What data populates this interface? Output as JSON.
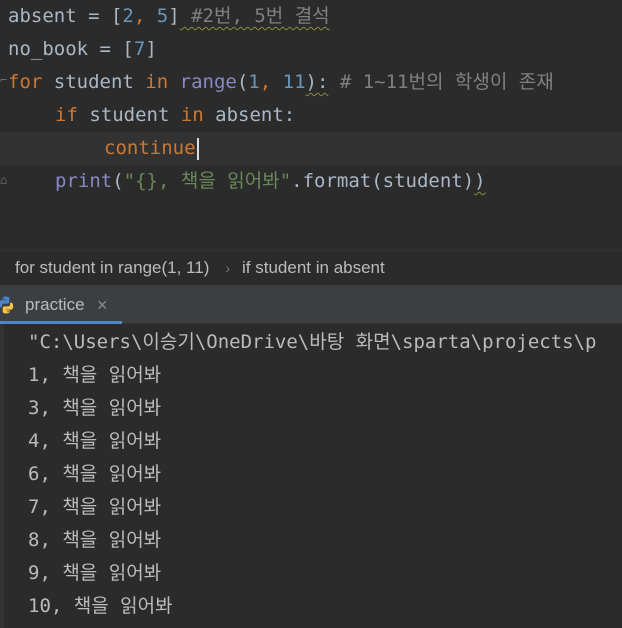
{
  "editor": {
    "line1": {
      "var": "absent",
      "op": " = ",
      "open": "[",
      "n1": "2",
      "sep": ", ",
      "n2": "5",
      "close": "]",
      "comment": " #2번, 5번 결석"
    },
    "line2": {
      "var": "no_book",
      "op": " = ",
      "open": "[",
      "n1": "7",
      "close": "]"
    },
    "line3": {
      "kw_for": "for",
      "var": " student ",
      "kw_in": "in",
      "sp": " ",
      "builtin": "range",
      "open": "(",
      "n1": "1",
      "sep": ", ",
      "n2": "11",
      "close": "):",
      "comment": " # 1~11번의 학생이 존재"
    },
    "line4": {
      "kw_if": "if",
      "var": " student ",
      "kw_in": "in",
      "rest": " absent:"
    },
    "line5": {
      "kw": "continue"
    },
    "line6": {
      "builtin": "print",
      "open": "(",
      "str": "\"{}, 책을 읽어봐\"",
      "rest": ".format(student)",
      "close": ")"
    }
  },
  "breadcrumb": {
    "item1": "for student in range(1, 11)",
    "separator": "›",
    "item2": "if student in absent"
  },
  "run_panel": {
    "tab_label": "practice",
    "tab_close": "×",
    "tab_icon": "python-icon"
  },
  "console": {
    "lines": [
      "\"C:\\Users\\이승기\\OneDrive\\바탕 화면\\sparta\\projects\\p",
      "1, 책을 읽어봐",
      "3, 책을 읽어봐",
      "4, 책을 읽어봐",
      "6, 책을 읽어봐",
      "7, 책을 읽어봐",
      "8, 책을 읽어봐",
      "9, 책을 읽어봐",
      "10, 책을 읽어봐"
    ]
  },
  "colors": {
    "background": "#2b2b2b",
    "keyword": "#cc7832",
    "number": "#6897bb",
    "string": "#6a8759",
    "builtin": "#8888c6",
    "comment": "#808080",
    "tab_accent": "#4a88c7"
  }
}
